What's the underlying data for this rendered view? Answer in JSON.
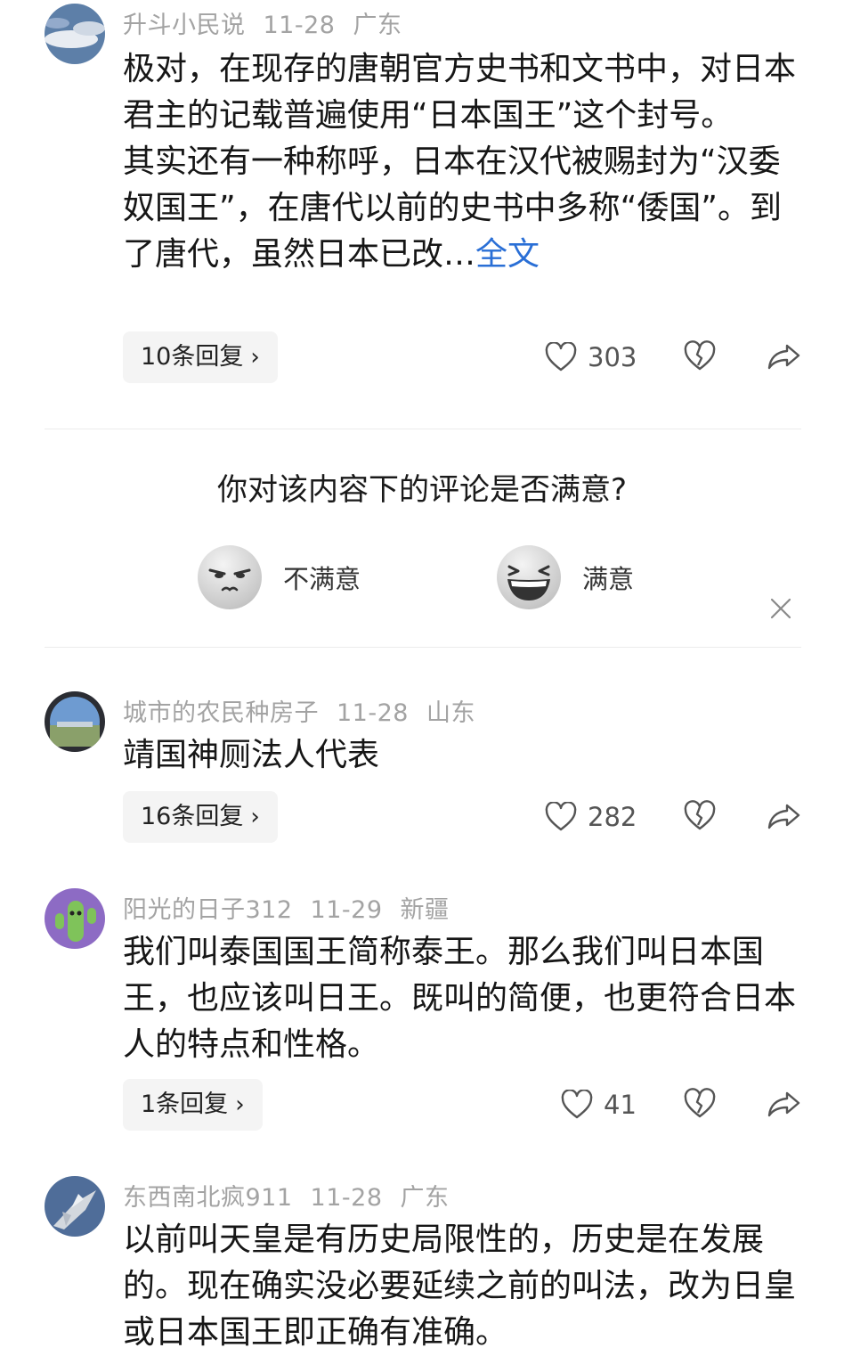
{
  "comments": [
    {
      "user": "升斗小民说",
      "date": "11-28",
      "location": "广东",
      "paragraphs": [
        "极对，在现存的唐朝官方史书和文书中，对日本君主的记载普遍使用“日本国王”这个封号。",
        "其实还有一种称呼，日本在汉代被赐封为“汉委奴国王”，在唐代以前的史书中多称“倭国”。到了唐代，虽然日本已改…"
      ],
      "more_label": "全文",
      "replies_label": "10条回复",
      "likes": "303"
    },
    {
      "user": "城市的农民种房子",
      "date": "11-28",
      "location": "山东",
      "paragraphs": [
        "靖国神厕法人代表"
      ],
      "replies_label": "16条回复",
      "likes": "282"
    },
    {
      "user": "阳光的日子312",
      "date": "11-29",
      "location": "新疆",
      "paragraphs": [
        "我们叫泰国国王简称泰王。那么我们叫日本国王，也应该叫日王。既叫的简便，也更符合日本人的特点和性格。"
      ],
      "replies_label": "1条回复",
      "likes": "41"
    },
    {
      "user": "东西南北疯911",
      "date": "11-28",
      "location": "广东",
      "paragraphs": [
        "以前叫天皇是有历史局限性的，历史是在发展的。现在确实没必要延续之前的叫法，改为日皇或日本国王即正确有准确。"
      ]
    }
  ],
  "survey": {
    "question": "你对该内容下的评论是否满意?",
    "option_bad": "不满意",
    "option_good": "满意"
  },
  "icons": {
    "like": "heart-outline-icon",
    "dislike": "broken-heart-icon",
    "share": "share-arrow-icon",
    "close": "close-icon",
    "chevron": "chevron-right-icon"
  },
  "colors": {
    "link": "#2a6fd6",
    "meta": "#a3a3a3",
    "reply_bg": "#f4f4f4"
  }
}
